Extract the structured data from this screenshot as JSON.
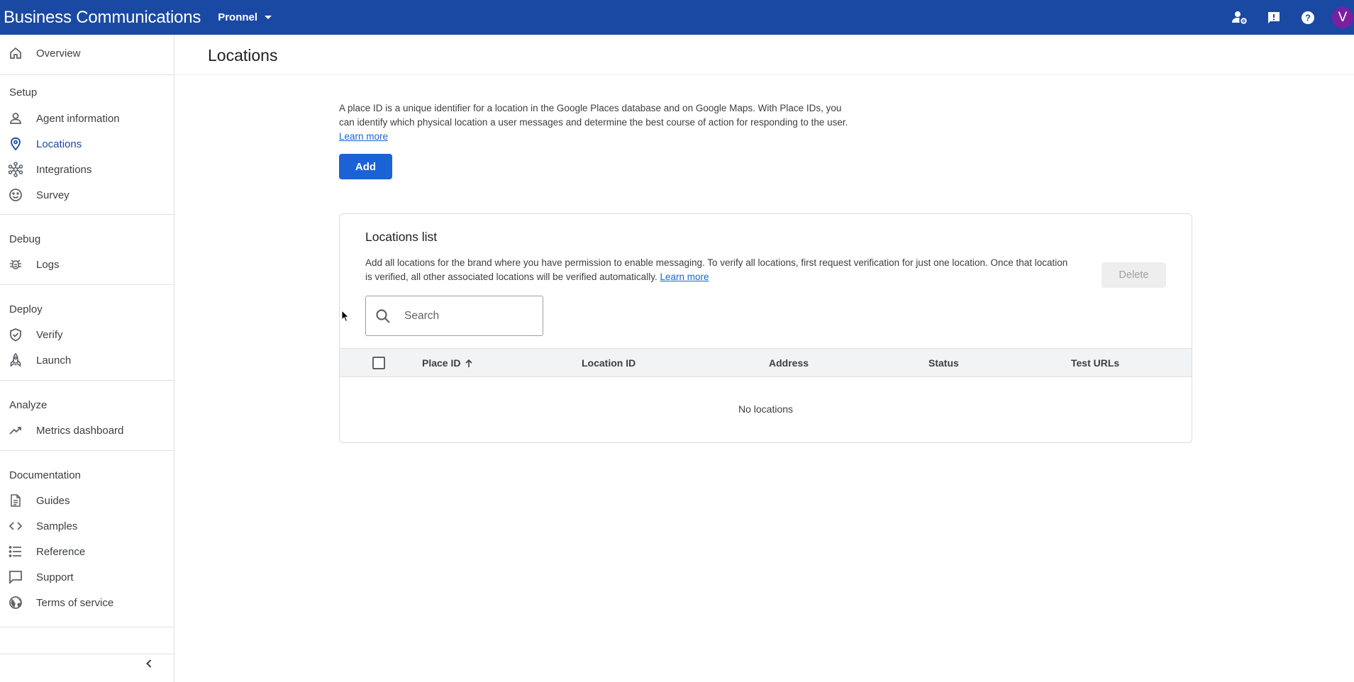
{
  "header": {
    "app_title": "Business Communications",
    "account": "Pronnel",
    "icons": [
      "manage-accounts-icon",
      "feedback-icon",
      "help-icon"
    ],
    "avatar_initial": "V",
    "brand_color": "#1a49a3",
    "avatar_color": "#7b1fa2"
  },
  "sidebar": {
    "overview": "Overview",
    "sections": {
      "setup": "Setup",
      "debug": "Debug",
      "deploy": "Deploy",
      "analyze": "Analyze",
      "documentation": "Documentation"
    },
    "items": {
      "agent_information": "Agent information",
      "locations": "Locations",
      "integrations": "Integrations",
      "survey": "Survey",
      "logs": "Logs",
      "verify": "Verify",
      "launch": "Launch",
      "metrics_dashboard": "Metrics dashboard",
      "guides": "Guides",
      "samples": "Samples",
      "reference": "Reference",
      "support": "Support",
      "terms_of_service": "Terms of service"
    },
    "active_item": "Locations"
  },
  "main": {
    "page_title": "Locations",
    "intro_text": "A place ID is a unique identifier for a location in the Google Places database and on Google Maps. With Place IDs, you can identify which physical location a user messages and determine the best course of action for responding to the user.",
    "intro_link": "Learn more",
    "add_button": "Add",
    "card": {
      "title": "Locations list",
      "description": "Add all locations for the brand where you have permission to enable messaging. To verify all locations, first request verification for just one location. Once that location is verified, all other associated locations will be verified automatically.",
      "description_link": "Learn more",
      "delete_button": "Delete",
      "search_placeholder": "Search",
      "search_value": "",
      "columns": {
        "place_id": "Place ID",
        "location_id": "Location ID",
        "address": "Address",
        "status": "Status",
        "test_urls": "Test URLs"
      },
      "sort_column": "Place ID",
      "sort_direction": "ascending",
      "empty_message": "No locations"
    }
  }
}
